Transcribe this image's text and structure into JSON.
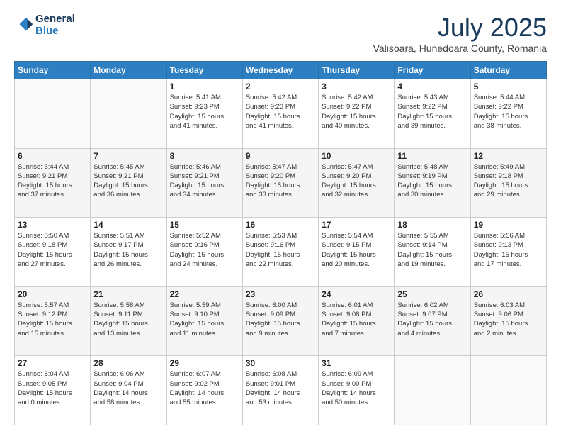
{
  "logo": {
    "line1": "General",
    "line2": "Blue"
  },
  "header": {
    "month_title": "July 2025",
    "location": "Valisoara, Hunedoara County, Romania"
  },
  "weekdays": [
    "Sunday",
    "Monday",
    "Tuesday",
    "Wednesday",
    "Thursday",
    "Friday",
    "Saturday"
  ],
  "weeks": [
    [
      {
        "num": "",
        "info": ""
      },
      {
        "num": "",
        "info": ""
      },
      {
        "num": "1",
        "info": "Sunrise: 5:41 AM\nSunset: 9:23 PM\nDaylight: 15 hours\nand 41 minutes."
      },
      {
        "num": "2",
        "info": "Sunrise: 5:42 AM\nSunset: 9:23 PM\nDaylight: 15 hours\nand 41 minutes."
      },
      {
        "num": "3",
        "info": "Sunrise: 5:42 AM\nSunset: 9:22 PM\nDaylight: 15 hours\nand 40 minutes."
      },
      {
        "num": "4",
        "info": "Sunrise: 5:43 AM\nSunset: 9:22 PM\nDaylight: 15 hours\nand 39 minutes."
      },
      {
        "num": "5",
        "info": "Sunrise: 5:44 AM\nSunset: 9:22 PM\nDaylight: 15 hours\nand 38 minutes."
      }
    ],
    [
      {
        "num": "6",
        "info": "Sunrise: 5:44 AM\nSunset: 9:21 PM\nDaylight: 15 hours\nand 37 minutes."
      },
      {
        "num": "7",
        "info": "Sunrise: 5:45 AM\nSunset: 9:21 PM\nDaylight: 15 hours\nand 36 minutes."
      },
      {
        "num": "8",
        "info": "Sunrise: 5:46 AM\nSunset: 9:21 PM\nDaylight: 15 hours\nand 34 minutes."
      },
      {
        "num": "9",
        "info": "Sunrise: 5:47 AM\nSunset: 9:20 PM\nDaylight: 15 hours\nand 33 minutes."
      },
      {
        "num": "10",
        "info": "Sunrise: 5:47 AM\nSunset: 9:20 PM\nDaylight: 15 hours\nand 32 minutes."
      },
      {
        "num": "11",
        "info": "Sunrise: 5:48 AM\nSunset: 9:19 PM\nDaylight: 15 hours\nand 30 minutes."
      },
      {
        "num": "12",
        "info": "Sunrise: 5:49 AM\nSunset: 9:18 PM\nDaylight: 15 hours\nand 29 minutes."
      }
    ],
    [
      {
        "num": "13",
        "info": "Sunrise: 5:50 AM\nSunset: 9:18 PM\nDaylight: 15 hours\nand 27 minutes."
      },
      {
        "num": "14",
        "info": "Sunrise: 5:51 AM\nSunset: 9:17 PM\nDaylight: 15 hours\nand 26 minutes."
      },
      {
        "num": "15",
        "info": "Sunrise: 5:52 AM\nSunset: 9:16 PM\nDaylight: 15 hours\nand 24 minutes."
      },
      {
        "num": "16",
        "info": "Sunrise: 5:53 AM\nSunset: 9:16 PM\nDaylight: 15 hours\nand 22 minutes."
      },
      {
        "num": "17",
        "info": "Sunrise: 5:54 AM\nSunset: 9:15 PM\nDaylight: 15 hours\nand 20 minutes."
      },
      {
        "num": "18",
        "info": "Sunrise: 5:55 AM\nSunset: 9:14 PM\nDaylight: 15 hours\nand 19 minutes."
      },
      {
        "num": "19",
        "info": "Sunrise: 5:56 AM\nSunset: 9:13 PM\nDaylight: 15 hours\nand 17 minutes."
      }
    ],
    [
      {
        "num": "20",
        "info": "Sunrise: 5:57 AM\nSunset: 9:12 PM\nDaylight: 15 hours\nand 15 minutes."
      },
      {
        "num": "21",
        "info": "Sunrise: 5:58 AM\nSunset: 9:11 PM\nDaylight: 15 hours\nand 13 minutes."
      },
      {
        "num": "22",
        "info": "Sunrise: 5:59 AM\nSunset: 9:10 PM\nDaylight: 15 hours\nand 11 minutes."
      },
      {
        "num": "23",
        "info": "Sunrise: 6:00 AM\nSunset: 9:09 PM\nDaylight: 15 hours\nand 9 minutes."
      },
      {
        "num": "24",
        "info": "Sunrise: 6:01 AM\nSunset: 9:08 PM\nDaylight: 15 hours\nand 7 minutes."
      },
      {
        "num": "25",
        "info": "Sunrise: 6:02 AM\nSunset: 9:07 PM\nDaylight: 15 hours\nand 4 minutes."
      },
      {
        "num": "26",
        "info": "Sunrise: 6:03 AM\nSunset: 9:06 PM\nDaylight: 15 hours\nand 2 minutes."
      }
    ],
    [
      {
        "num": "27",
        "info": "Sunrise: 6:04 AM\nSunset: 9:05 PM\nDaylight: 15 hours\nand 0 minutes."
      },
      {
        "num": "28",
        "info": "Sunrise: 6:06 AM\nSunset: 9:04 PM\nDaylight: 14 hours\nand 58 minutes."
      },
      {
        "num": "29",
        "info": "Sunrise: 6:07 AM\nSunset: 9:02 PM\nDaylight: 14 hours\nand 55 minutes."
      },
      {
        "num": "30",
        "info": "Sunrise: 6:08 AM\nSunset: 9:01 PM\nDaylight: 14 hours\nand 53 minutes."
      },
      {
        "num": "31",
        "info": "Sunrise: 6:09 AM\nSunset: 9:00 PM\nDaylight: 14 hours\nand 50 minutes."
      },
      {
        "num": "",
        "info": ""
      },
      {
        "num": "",
        "info": ""
      }
    ]
  ]
}
